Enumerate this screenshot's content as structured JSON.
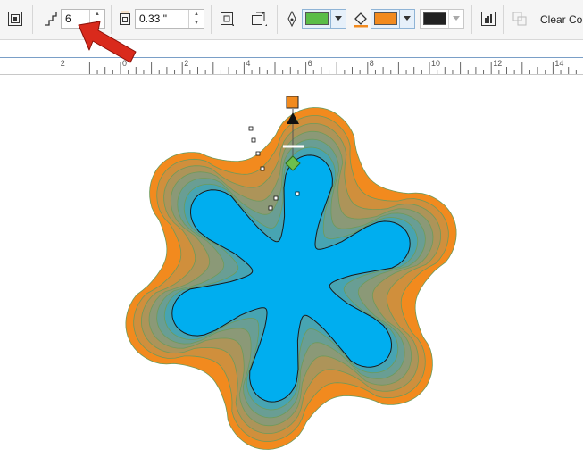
{
  "toolbar": {
    "steps_value": "6",
    "offset_value": "0.33 \"",
    "clear_label": "Clear Con",
    "outline_color": "#5bbd48",
    "fill_color": "#f28a1e",
    "third_color": "#222222"
  },
  "ruler": {
    "ticks": [
      "2",
      "0",
      "2",
      "4",
      "6",
      "8",
      "10",
      "12",
      "14"
    ]
  },
  "shape": {
    "outer_color": "#f28a1e",
    "inner_color": "#00aeef",
    "steps": 6,
    "handle_start_color": "#f28a1e",
    "handle_end_color": "#6dbf4b"
  }
}
